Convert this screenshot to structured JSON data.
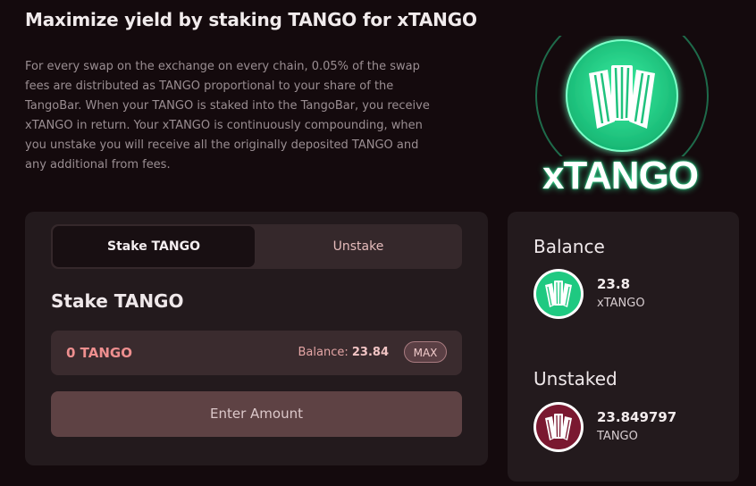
{
  "header": {
    "title": "Maximize yield by staking TANGO for xTANGO",
    "description": "For every swap on the exchange on every chain, 0.05% of the swap fees are distributed as TANGO proportional to your share of the TangoBar. When your TANGO is staked into the TangoBar, you receive xTANGO in return. Your xTANGO is continuously compounding, when you unstake you will receive all the originally deposited TANGO and any additional from fees."
  },
  "logo": {
    "text": "xTANGO",
    "icon": "accordion-icon"
  },
  "stake": {
    "tabs": [
      "Stake TANGO",
      "Unstake"
    ],
    "active_tab": "Stake TANGO",
    "heading": "Stake TANGO",
    "amount_value": "0 TANGO",
    "balance_label": "Balance:",
    "balance_value": "23.84",
    "max_label": "MAX",
    "enter_button": "Enter Amount"
  },
  "sidebar": {
    "balance": {
      "heading": "Balance",
      "amount": "23.8",
      "symbol": "xTANGO",
      "icon": "xtango-token-icon"
    },
    "unstaked": {
      "heading": "Unstaked",
      "amount": "23.849797",
      "symbol": "TANGO",
      "icon": "tango-token-icon"
    }
  },
  "colors": {
    "accent_green": "#2cd88e",
    "accent_maroon": "#7a1830",
    "muted_pink": "#ee8f8f"
  }
}
